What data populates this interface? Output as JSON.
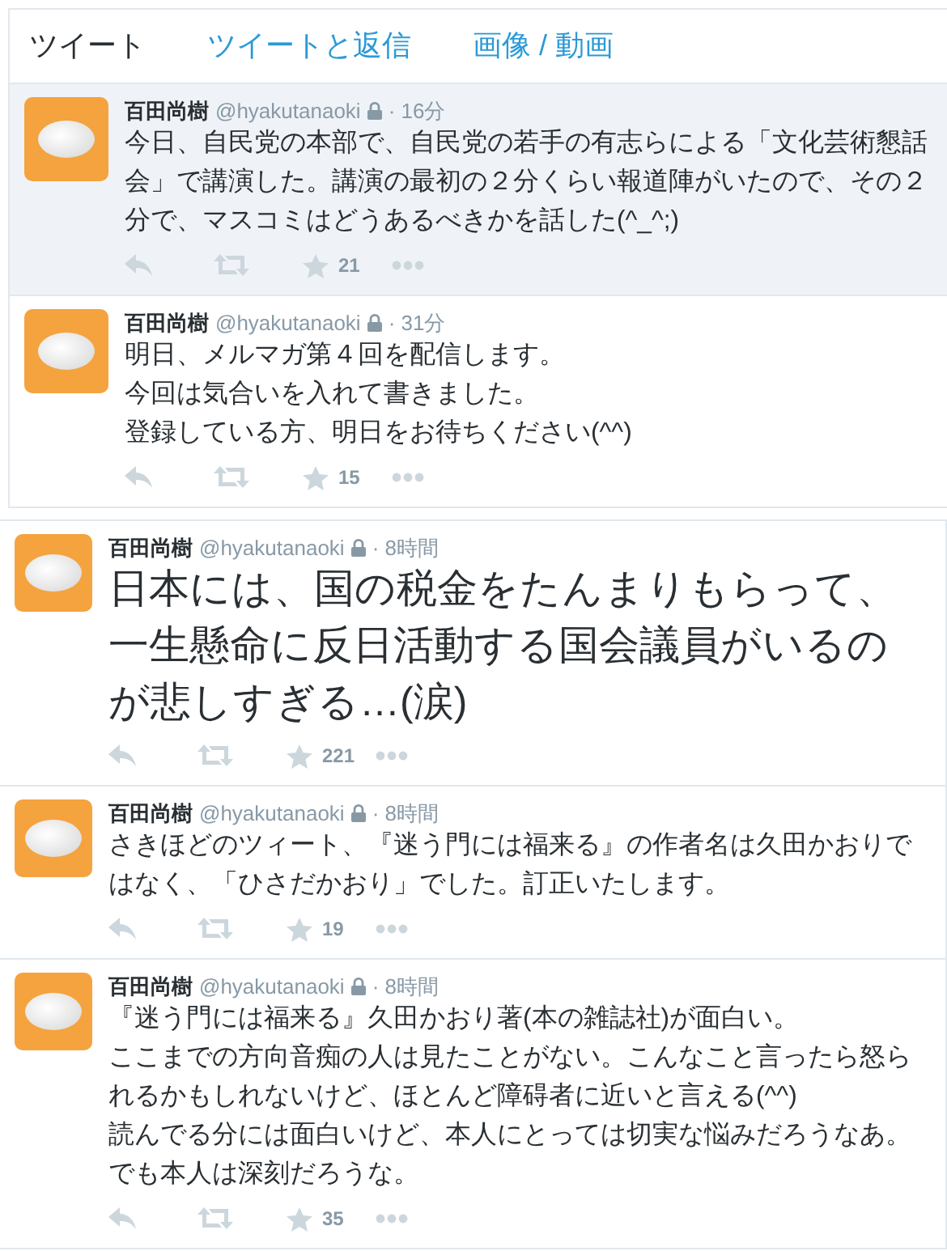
{
  "tabs": [
    {
      "label": "ツイート",
      "selected": true
    },
    {
      "label": "ツイートと返信",
      "selected": false
    },
    {
      "label": "画像 / 動画",
      "selected": false
    }
  ],
  "panels": [
    {
      "tweets": [
        {
          "name": "百田尚樹",
          "handle": "@hyakutanaoki",
          "protected": true,
          "time": "· 16分",
          "lines": [
            "今日、自民党の本部で、自民党の若手の有志らによる「文化芸術懇話会」で講演した。講演の最初の２分くらい報道陣がいたので、その２分で、マスコミはどうあるべきかを話した(^_^;)"
          ],
          "kind": "normal",
          "highlighted": true,
          "favorites": "21"
        },
        {
          "name": "百田尚樹",
          "handle": "@hyakutanaoki",
          "protected": true,
          "time": "· 31分",
          "lines": [
            "明日、メルマガ第４回を配信します。",
            "今回は気合いを入れて書きました。",
            "登録している方、明日をお待ちください(^^)"
          ],
          "kind": "normal",
          "highlighted": false,
          "favorites": "15"
        }
      ]
    },
    {
      "tweets": [
        {
          "name": "百田尚樹",
          "handle": "@hyakutanaoki",
          "protected": true,
          "time": "· 8時間",
          "lines": [
            "日本には、国の税金をたんまりもらって、一生懸命に反日活動する国会議員がいるのが悲しすぎる…(涙)"
          ],
          "kind": "large",
          "highlighted": false,
          "favorites": "221"
        },
        {
          "name": "百田尚樹",
          "handle": "@hyakutanaoki",
          "protected": true,
          "time": "· 8時間",
          "lines": [
            "さきほどのツィート、『迷う門には福来る』の作者名は久田かおりではなく、「ひさだかおり」でした。訂正いたします。"
          ],
          "kind": "normal",
          "highlighted": false,
          "favorites": "19"
        },
        {
          "name": "百田尚樹",
          "handle": "@hyakutanaoki",
          "protected": true,
          "time": "· 8時間",
          "lines": [
            "『迷う門には福来る』久田かおり著(本の雑誌社)が面白い。",
            "ここまでの方向音痴の人は見たことがない。こんなこと言ったら怒られるかもしれないけど、ほとんど障碍者に近いと言える(^^)",
            "読んでる分には面白いけど、本人にとっては切実な悩みだろうなあ。",
            "でも本人は深刻だろうな。"
          ],
          "kind": "normal",
          "highlighted": false,
          "favorites": "35"
        }
      ]
    }
  ]
}
